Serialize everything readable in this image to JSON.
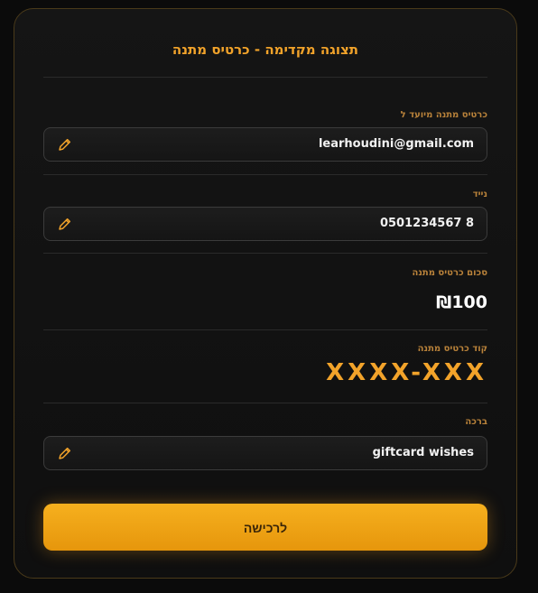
{
  "header": {
    "title": "תצוגה מקדימה - כרטיס מתנה"
  },
  "recipient": {
    "label": "כרטיס מתנה מיועד ל",
    "value": "learhoudini@gmail.com"
  },
  "phone": {
    "label": "נייד",
    "value": "0501234567 8"
  },
  "amount": {
    "label": "סכום כרטיס מתנה",
    "value": "₪100"
  },
  "code": {
    "label": "קוד כרטיס מתנה",
    "value": "XXXX-XXX"
  },
  "greeting": {
    "label": "ברכה",
    "value": "giftcard wishes"
  },
  "actions": {
    "purchase_label": "לרכישה"
  },
  "colors": {
    "accent": "#f2a32a",
    "background": "#0b0b0b",
    "label": "#b9823a"
  }
}
